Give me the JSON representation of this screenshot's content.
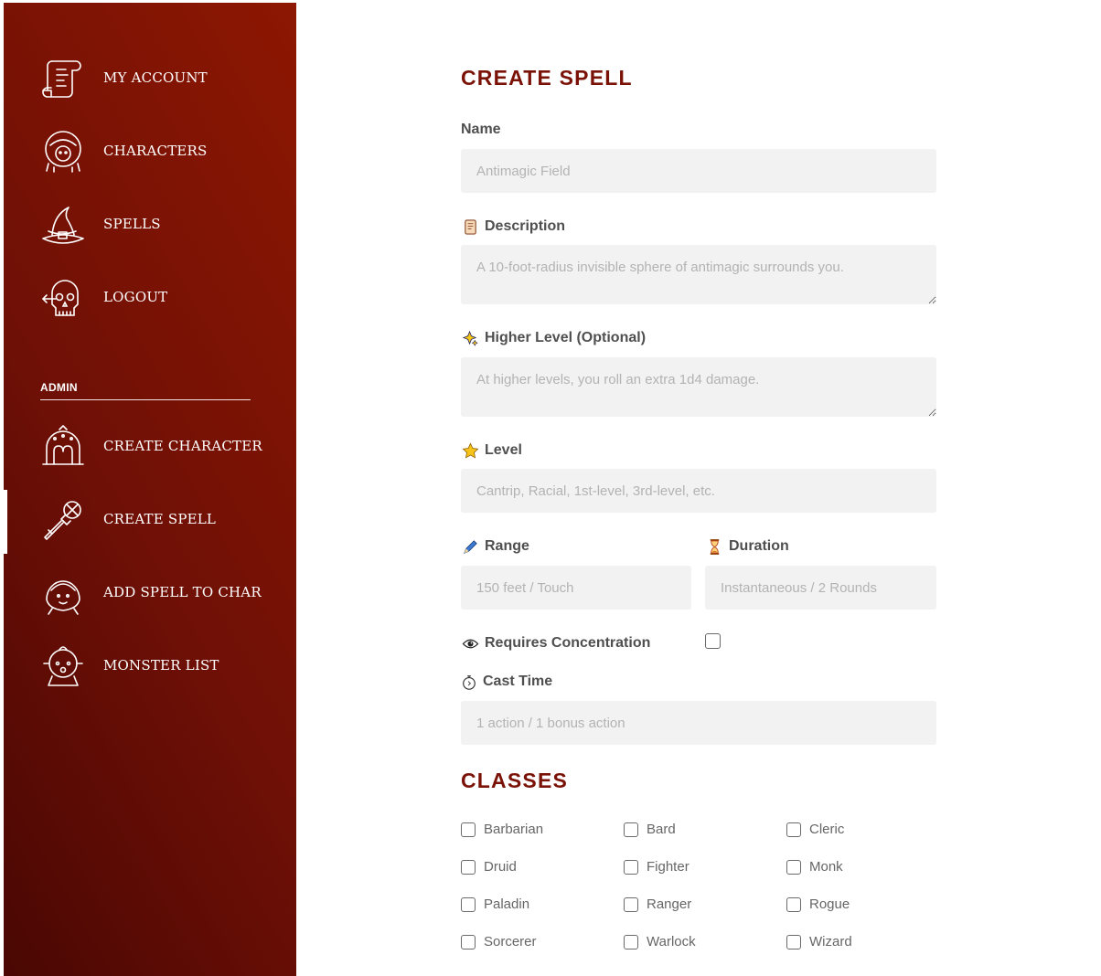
{
  "sidebar": {
    "items": [
      {
        "label": "MY ACCOUNT",
        "icon": "scroll-icon"
      },
      {
        "label": "CHARACTERS",
        "icon": "character-face-icon"
      },
      {
        "label": "SPELLS",
        "icon": "wizard-hat-icon"
      },
      {
        "label": "LOGOUT",
        "icon": "skull-icon"
      }
    ],
    "admin_label": "ADMIN",
    "admin_items": [
      {
        "label": "CREATE CHARACTER",
        "icon": "helmet-icon"
      },
      {
        "label": "CREATE SPELL",
        "icon": "magic-wand-icon",
        "active": true
      },
      {
        "label": "ADD SPELL TO CHAR",
        "icon": "girl-face-icon"
      },
      {
        "label": "MONSTER LIST",
        "icon": "baby-monster-icon"
      }
    ],
    "colors": {
      "gradient_start": "#4a0703",
      "gradient_end": "#8d1702"
    }
  },
  "form": {
    "title": "CREATE SPELL",
    "name": {
      "label": "Name",
      "placeholder": "Antimagic Field"
    },
    "description": {
      "label": "Description",
      "icon": "scroll-emoji-icon",
      "placeholder": "A 10-foot-radius invisible sphere of antimagic surrounds you."
    },
    "higher_level": {
      "label": "Higher Level (Optional)",
      "icon": "sparkles-icon",
      "placeholder": "At higher levels, you roll an extra 1d4 damage."
    },
    "level": {
      "label": "Level",
      "icon": "star-icon",
      "placeholder": "Cantrip, Racial, 1st-level, 3rd-level, etc."
    },
    "range": {
      "label": "Range",
      "icon": "crayon-icon",
      "placeholder": "150 feet / Touch"
    },
    "duration": {
      "label": "Duration",
      "icon": "hourglass-icon",
      "placeholder": "Instantaneous / 2 Rounds"
    },
    "concentration": {
      "label": "Requires Concentration",
      "icon": "eye-icon",
      "checked": false
    },
    "cast_time": {
      "label": "Cast Time",
      "icon": "stopwatch-icon",
      "placeholder": "1 action / 1 bonus action"
    }
  },
  "classes": {
    "title": "CLASSES",
    "items": [
      "Barbarian",
      "Bard",
      "Cleric",
      "Druid",
      "Fighter",
      "Monk",
      "Paladin",
      "Ranger",
      "Rogue",
      "Sorcerer",
      "Warlock",
      "Wizard"
    ]
  },
  "accent_color": "#7a1207"
}
